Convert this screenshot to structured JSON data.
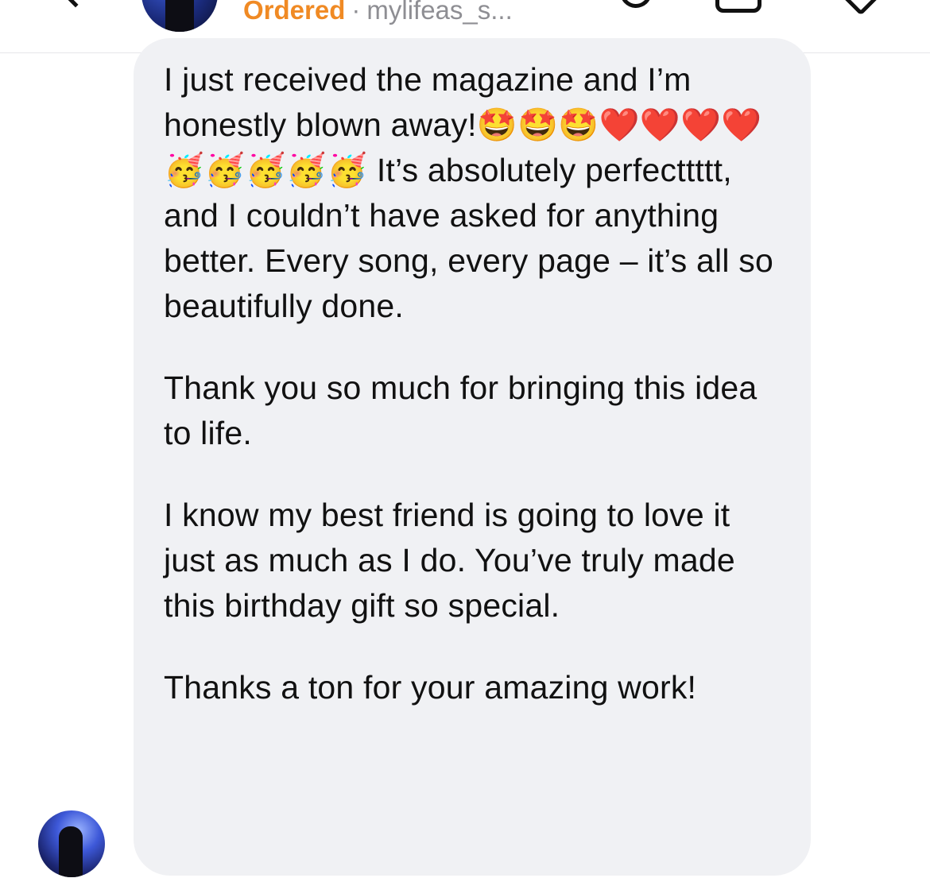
{
  "header": {
    "status": "Ordered",
    "separator": "·",
    "username": "mylifeas_s...",
    "back_icon": "chevron-left-icon",
    "call_icon": "phone-icon",
    "video_icon": "video-camera-icon",
    "info_icon": "chevron-down-icon"
  },
  "colors": {
    "status": "#f08a24",
    "bubble_bg": "#f0f1f4",
    "secondary_text": "#8e8e93"
  },
  "message": {
    "paragraph_1": "I just received the magazine and I’m honestly blown away!🤩🤩🤩❤️❤️❤️❤️🥳🥳🥳🥳🥳 It’s absolutely perfecttttt, and I couldn’t have asked for anything better. Every song, every page – it’s all so beautifully done.",
    "paragraph_2": "Thank you so much for bringing this idea to life.",
    "paragraph_3": "I know my best friend is going to love it just as much as I do. You’ve truly made this birthday gift so special.",
    "paragraph_4": "Thanks a ton for your amazing work!"
  }
}
